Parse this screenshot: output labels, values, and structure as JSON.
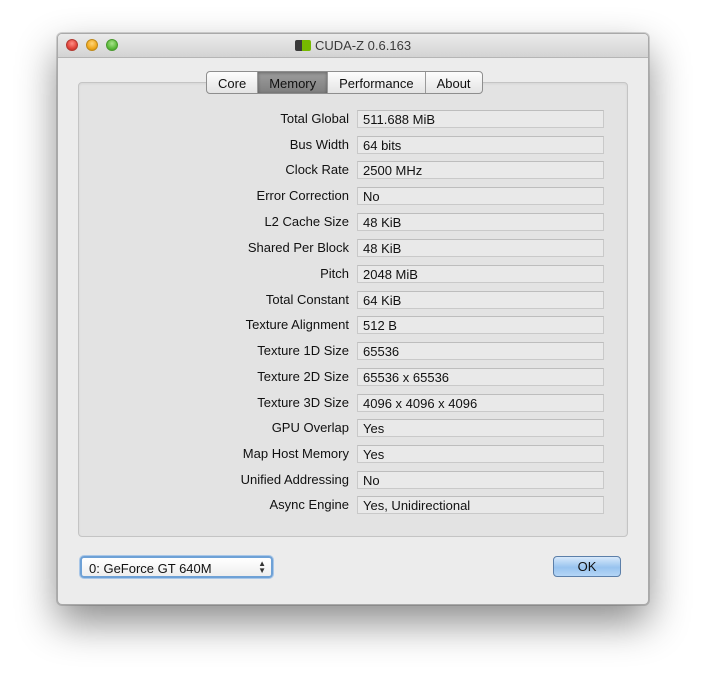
{
  "window": {
    "title": "CUDA-Z 0.6.163"
  },
  "tabs": [
    {
      "label": "Core",
      "active": false
    },
    {
      "label": "Memory",
      "active": true
    },
    {
      "label": "Performance",
      "active": false
    },
    {
      "label": "About",
      "active": false
    }
  ],
  "memory": {
    "rows": [
      {
        "label": "Total Global",
        "value": "511.688 MiB"
      },
      {
        "label": "Bus Width",
        "value": "64 bits"
      },
      {
        "label": "Clock Rate",
        "value": "2500 MHz"
      },
      {
        "label": "Error Correction",
        "value": "No"
      },
      {
        "label": "L2 Cache Size",
        "value": "48 KiB"
      },
      {
        "label": "Shared Per Block",
        "value": "48 KiB"
      },
      {
        "label": "Pitch",
        "value": "2048 MiB"
      },
      {
        "label": "Total Constant",
        "value": "64 KiB"
      },
      {
        "label": "Texture Alignment",
        "value": "512 B"
      },
      {
        "label": "Texture 1D Size",
        "value": "65536"
      },
      {
        "label": "Texture 2D Size",
        "value": "65536 x 65536"
      },
      {
        "label": "Texture 3D Size",
        "value": "4096 x 4096 x 4096"
      },
      {
        "label": "GPU Overlap",
        "value": "Yes"
      },
      {
        "label": "Map Host Memory",
        "value": "Yes"
      },
      {
        "label": "Unified Addressing",
        "value": "No"
      },
      {
        "label": "Async Engine",
        "value": "Yes, Unidirectional"
      }
    ]
  },
  "device_select": {
    "selected": "0: GeForce GT 640M"
  },
  "ok_label": "OK"
}
